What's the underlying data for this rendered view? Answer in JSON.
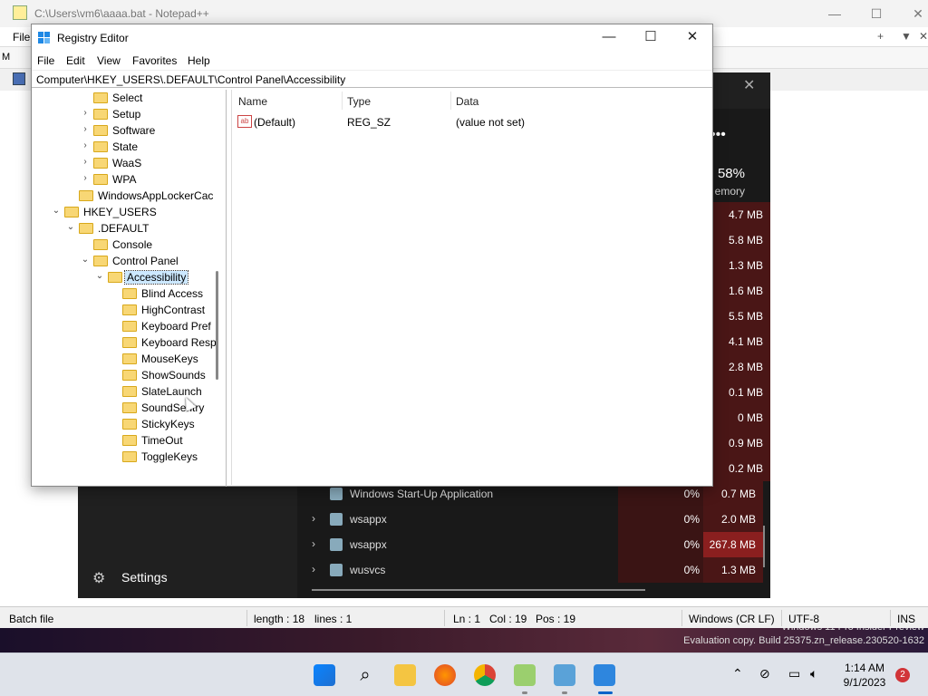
{
  "notepad": {
    "title": "C:\\Users\\vm6\\aaaa.bat - Notepad++",
    "menu_first": "File",
    "status": {
      "file_type": "Batch file",
      "length": "length : 18",
      "lines": "lines : 1",
      "ln": "Ln : 1",
      "col": "Col : 19",
      "pos": "Pos : 19",
      "eol": "Windows (CR LF)",
      "encoding": "UTF-8",
      "mode": "INS"
    },
    "side_letter": "M"
  },
  "task_manager": {
    "memory_pct": "58%",
    "memory_label": "emory",
    "mem_values": [
      "4.7 MB",
      "5.8 MB",
      "1.3 MB",
      "1.6 MB",
      "5.5 MB",
      "4.1 MB",
      "2.8 MB",
      "0.1 MB",
      "0 MB",
      "0.9 MB",
      "0.2 MB"
    ],
    "settings_label": "Settings",
    "rows": [
      {
        "name": "Windows Start-Up Application",
        "cpu": "0%",
        "mem": "0.7 MB",
        "expandable": false
      },
      {
        "name": "wsappx",
        "cpu": "0%",
        "mem": "2.0 MB",
        "expandable": true
      },
      {
        "name": "wsappx",
        "cpu": "0%",
        "mem": "267.8 MB",
        "expandable": true
      },
      {
        "name": "wusvcs",
        "cpu": "0%",
        "mem": "1.3 MB",
        "expandable": true
      }
    ]
  },
  "registry": {
    "title": "Registry Editor",
    "menu": [
      "File",
      "Edit",
      "View",
      "Favorites",
      "Help"
    ],
    "address": "Computer\\HKEY_USERS\\.DEFAULT\\Control Panel\\Accessibility",
    "tree": [
      {
        "label": "Select",
        "expander": ""
      },
      {
        "label": "Setup",
        "expander": "›"
      },
      {
        "label": "Software",
        "expander": "›"
      },
      {
        "label": "State",
        "expander": "›"
      },
      {
        "label": "WaaS",
        "expander": "›"
      },
      {
        "label": "WPA",
        "expander": "›"
      },
      {
        "label": "WindowsAppLockerCac",
        "expander": ""
      },
      {
        "label": "HKEY_USERS",
        "expander": "⌄"
      },
      {
        "label": ".DEFAULT",
        "expander": "⌄"
      },
      {
        "label": "Console",
        "expander": ""
      },
      {
        "label": "Control Panel",
        "expander": "⌄"
      },
      {
        "label": "Accessibility",
        "expander": "⌄"
      },
      {
        "label": "Blind Access",
        "expander": ""
      },
      {
        "label": "HighContrast",
        "expander": ""
      },
      {
        "label": "Keyboard Pref",
        "expander": ""
      },
      {
        "label": "Keyboard Resp",
        "expander": ""
      },
      {
        "label": "MouseKeys",
        "expander": ""
      },
      {
        "label": "ShowSounds",
        "expander": ""
      },
      {
        "label": "SlateLaunch",
        "expander": ""
      },
      {
        "label": "SoundSentry",
        "expander": ""
      },
      {
        "label": "StickyKeys",
        "expander": ""
      },
      {
        "label": "TimeOut",
        "expander": ""
      },
      {
        "label": "ToggleKeys",
        "expander": ""
      }
    ],
    "columns": [
      "Name",
      "Type",
      "Data"
    ],
    "values": [
      {
        "name": "(Default)",
        "type": "REG_SZ",
        "data": "(value not set)",
        "icon": "ab"
      }
    ]
  },
  "watermark": {
    "line1": "Windows 11 Pro Insider Preview",
    "line2": "Evaluation copy. Build 25375.zn_release.230520-1632"
  },
  "taskbar": {
    "time": "1:14 AM",
    "date": "9/1/2023",
    "notifications": "2"
  }
}
